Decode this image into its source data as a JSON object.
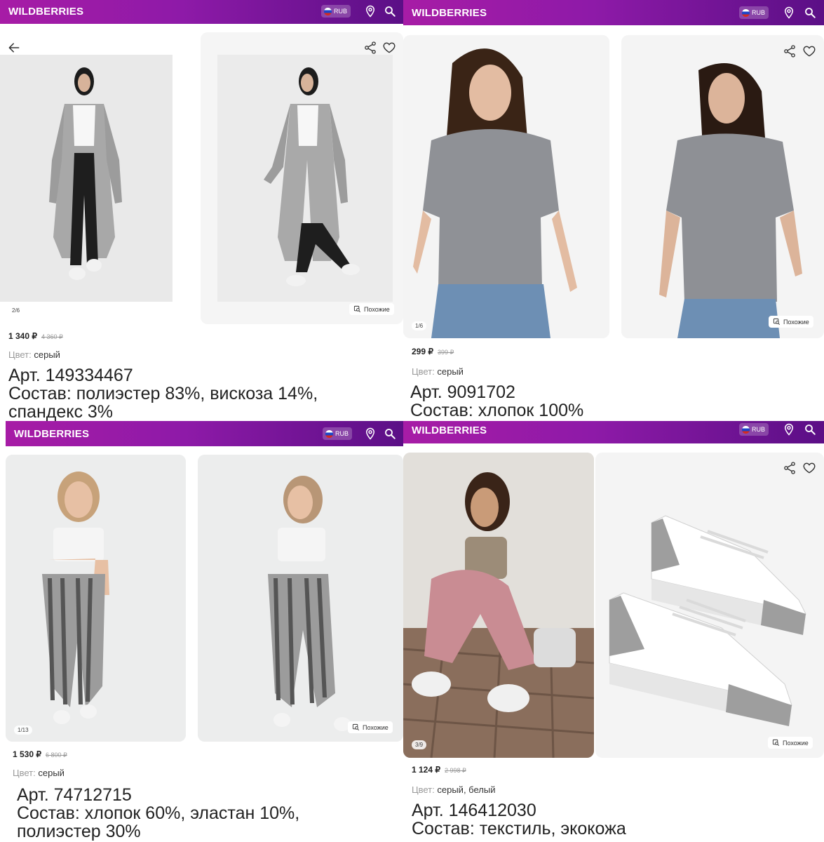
{
  "brand": "WILDBERRIES",
  "currency": "RUB",
  "similar_label": "Похожие",
  "color_label": "Цвет:",
  "accent_color": "#9a1fa9",
  "products": [
    {
      "counter": "2/6",
      "price": "1 340 ₽",
      "old_price": "4 360 ₽",
      "color": "серый",
      "article": "Арт. 149334467",
      "composition_1": "Состав: полиэстер 83%, вискоза 14%,",
      "composition_2": "спандекс 3%"
    },
    {
      "counter": "1/6",
      "price": "299 ₽",
      "old_price": "399 ₽",
      "color": "серый",
      "article": "Арт. 9091702",
      "composition_1": "Состав: хлопок 100%",
      "composition_2": ""
    },
    {
      "counter": "1/13",
      "price": "1 530 ₽",
      "old_price": "6 800 ₽",
      "color": "серый",
      "article": "Арт. 74712715",
      "composition_1": "Состав: хлопок 60%, эластан 10%,",
      "composition_2": "полиэстер 30%"
    },
    {
      "counter": "3/9",
      "price": "1 124 ₽",
      "old_price": "2 998 ₽",
      "color": "серый, белый",
      "article": "Арт. 146412030",
      "composition_1": "Состав: текстиль, экокожа",
      "composition_2": ""
    }
  ]
}
